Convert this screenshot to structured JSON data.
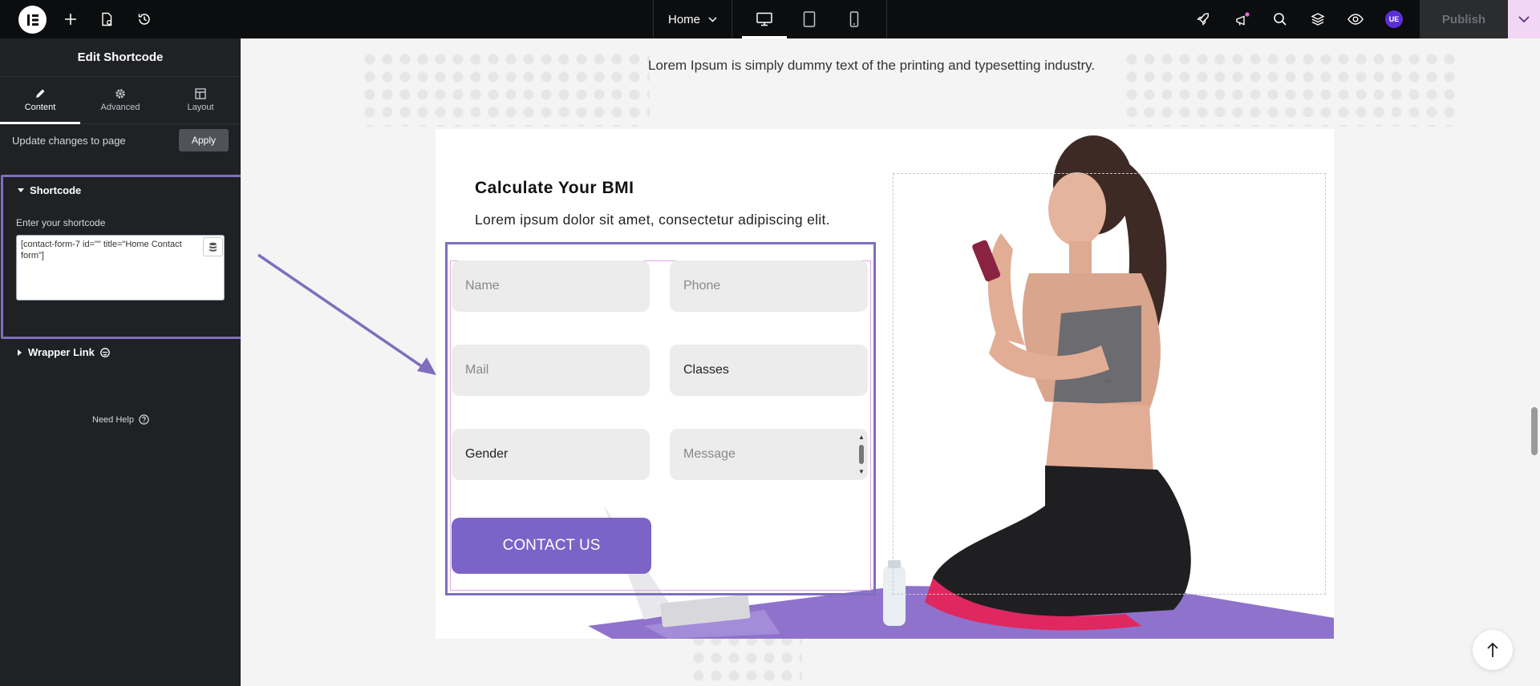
{
  "topbar": {
    "page_name": "Home",
    "publish_label": "Publish",
    "user_initials": "UE"
  },
  "panel": {
    "title": "Edit Shortcode",
    "tabs": [
      {
        "label": "Content"
      },
      {
        "label": "Advanced"
      },
      {
        "label": "Layout"
      }
    ],
    "update_text": "Update changes to page",
    "apply_label": "Apply",
    "shortcode_section": "Shortcode",
    "field_label": "Enter your shortcode",
    "shortcode_value": "[contact-form-7 id=\"\" title=\"Home Contact form\"]",
    "wrapper_section": "Wrapper Link",
    "need_help": "Need Help"
  },
  "canvas": {
    "subheading": "Lorem Ipsum is simply dummy text of the printing and typesetting industry.",
    "card_title": "Calculate Your BMI",
    "card_subtitle": "Lorem ipsum dolor sit amet, consectetur adipiscing elit.",
    "fields": {
      "name": "Name",
      "phone": "Phone",
      "mail": "Mail",
      "classes": "Classes",
      "gender": "Gender",
      "message": "Message"
    },
    "contact_button": "CONTACT US"
  },
  "colors": {
    "accent": "#7c63c8",
    "highlight": "#7f6ebd",
    "panel_bg": "#1f2124",
    "topbar_bg": "#0c0d0e"
  }
}
